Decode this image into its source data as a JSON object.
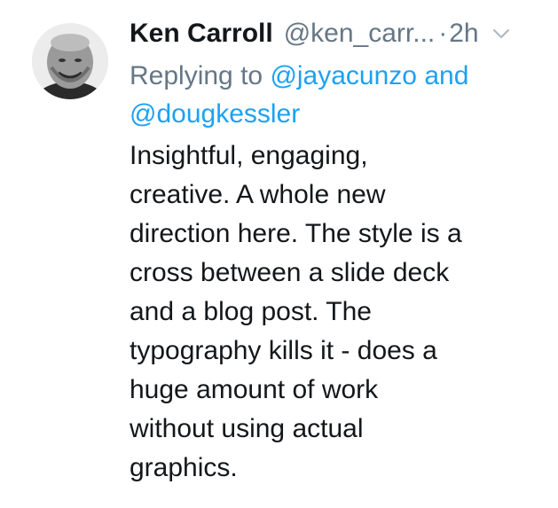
{
  "tweet": {
    "author_name": "Ken Carroll",
    "author_handle": "@ken_carr...",
    "separator": "·",
    "timestamp": "2h",
    "replying_prefix": "Replying to",
    "mention_1": "@jayacunzo",
    "replying_and": "and",
    "mention_2": "@dougkessler",
    "text_lines": [
      "Insightful, engaging,",
      "creative. A whole new",
      "direction here. The style is a",
      "cross between a slide deck",
      "and a blog post. The",
      "typography kills it - does a",
      "huge amount of work",
      "without using actual",
      "graphics."
    ]
  },
  "icons": {
    "avatar": "profile-photo",
    "menu": "chevron-down-icon"
  },
  "colors": {
    "name": "#14171a",
    "muted": "#657786",
    "link": "#1da1f2",
    "background": "#ffffff"
  }
}
